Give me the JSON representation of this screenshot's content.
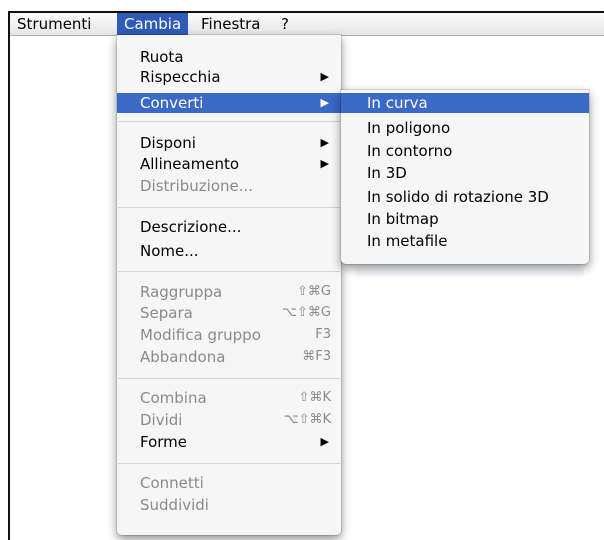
{
  "menubar": {
    "items": [
      {
        "label": "Strumenti"
      },
      {
        "label": "Cambia"
      },
      {
        "label": "Finestra"
      },
      {
        "label": "?"
      }
    ]
  },
  "menu": {
    "items": [
      {
        "label": "Ruota"
      },
      {
        "label": "Rispecchia",
        "arrow": "▶"
      },
      {
        "label": "Converti",
        "arrow": "▶"
      },
      {
        "label": "Disponi",
        "arrow": "▶"
      },
      {
        "label": "Allineamento",
        "arrow": "▶"
      },
      {
        "label": "Distribuzione..."
      },
      {
        "label": "Descrizione..."
      },
      {
        "label": "Nome..."
      },
      {
        "label": "Raggruppa",
        "shortcut": "⇧⌘G"
      },
      {
        "label": "Separa",
        "shortcut": "⌥⇧⌘G"
      },
      {
        "label": "Modifica gruppo",
        "shortcut": "F3"
      },
      {
        "label": "Abbandona",
        "shortcut": "⌘F3"
      },
      {
        "label": "Combina",
        "shortcut": "⇧⌘K"
      },
      {
        "label": "Dividi",
        "shortcut": "⌥⇧⌘K"
      },
      {
        "label": "Forme",
        "arrow": "▶"
      },
      {
        "label": "Connetti"
      },
      {
        "label": "Suddividi"
      }
    ]
  },
  "submenu": {
    "items": [
      {
        "label": "In curva"
      },
      {
        "label": "In poligono"
      },
      {
        "label": "In contorno"
      },
      {
        "label": "In 3D"
      },
      {
        "label": "In solido di rotazione 3D"
      },
      {
        "label": "In bitmap"
      },
      {
        "label": "In metafile"
      }
    ]
  }
}
